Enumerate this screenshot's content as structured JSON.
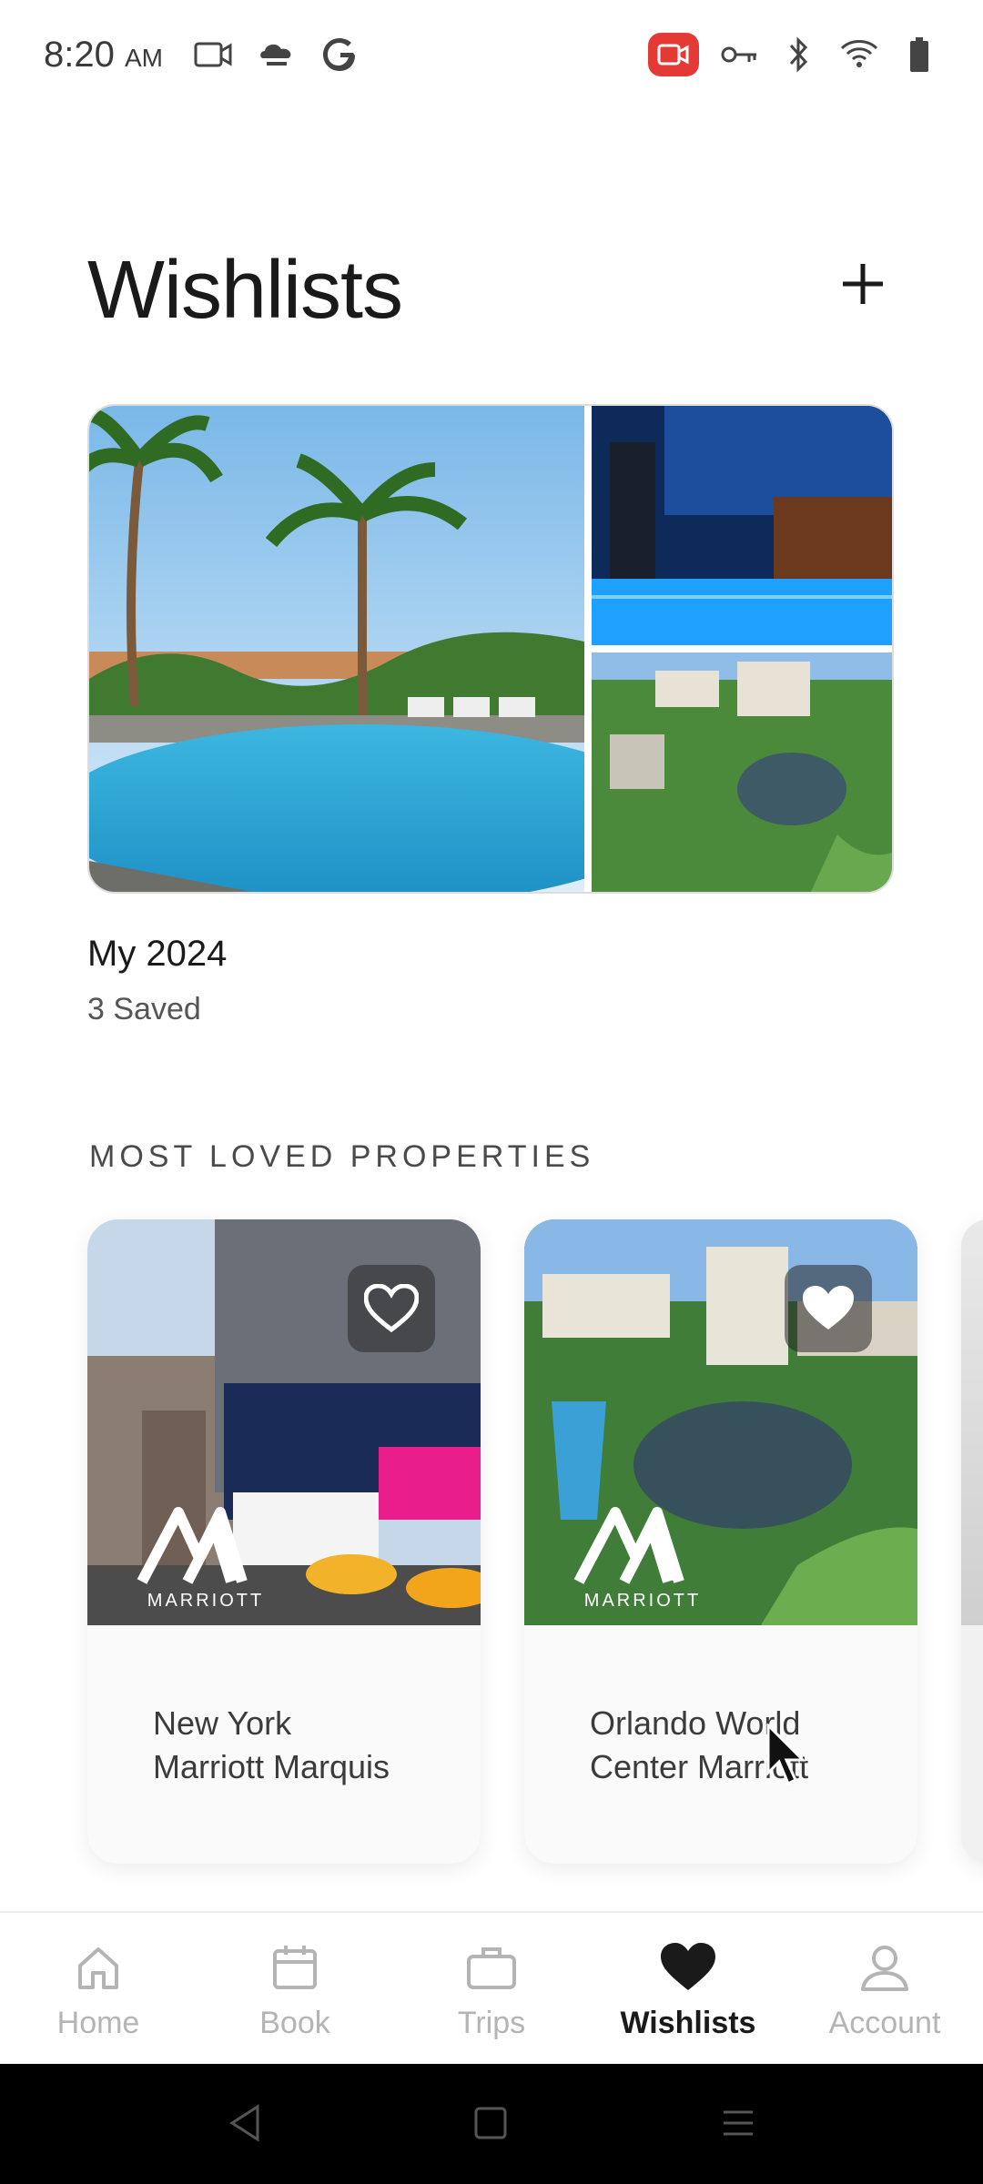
{
  "status_bar": {
    "time": "8:20",
    "ampm": "AM",
    "left_icons": [
      "video-call-icon",
      "cloud-sync-icon",
      "google-icon"
    ],
    "right_icons": [
      "screen-record-icon",
      "vpn-key-icon",
      "bluetooth-icon",
      "wifi-icon",
      "battery-icon"
    ]
  },
  "header": {
    "title": "Wishlists",
    "add_icon": "plus-icon"
  },
  "wishlist": {
    "name": "My 2024",
    "count_text": "3 Saved"
  },
  "section": {
    "title": "MOST LOVED PROPERTIES"
  },
  "properties": [
    {
      "name_line1": "New York",
      "name_line2": "Marriott Marquis",
      "brand": "MARRIOTT",
      "saved": false
    },
    {
      "name_line1": "Orlando World",
      "name_line2": "Center Marriott",
      "brand": "MARRIOTT",
      "saved": true
    }
  ],
  "bottom_nav": {
    "items": [
      {
        "label": "Home",
        "icon": "home-icon"
      },
      {
        "label": "Book",
        "icon": "calendar-icon"
      },
      {
        "label": "Trips",
        "icon": "briefcase-icon"
      },
      {
        "label": "Wishlists",
        "icon": "heart-icon"
      },
      {
        "label": "Account",
        "icon": "person-icon"
      }
    ],
    "active_index": 3
  },
  "colors": {
    "accent": "#f08a5d",
    "text": "#1a1a1a",
    "muted": "#b4b4b4",
    "record": "#e53935"
  }
}
